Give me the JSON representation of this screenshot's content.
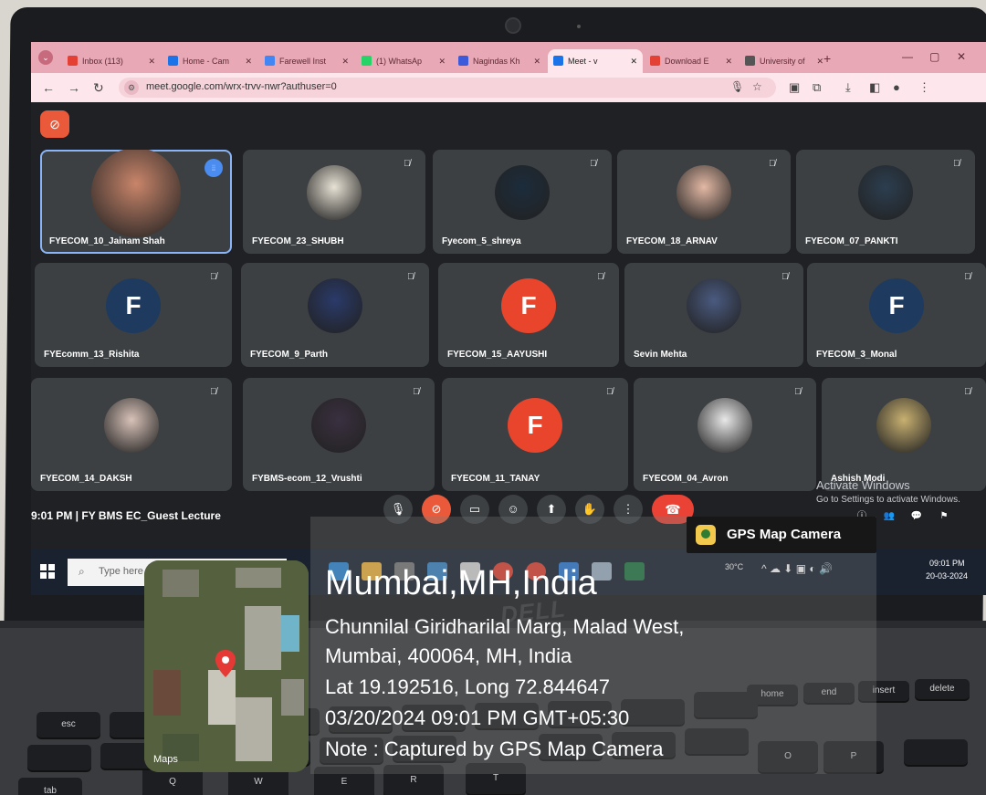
{
  "browser": {
    "tabs": [
      {
        "label": "Inbox (113)",
        "icon": "gmail-icon",
        "color": "#e44134"
      },
      {
        "label": "Home - Cam",
        "icon": "classroom-icon",
        "color": "#1a73e8"
      },
      {
        "label": "Farewell Inst",
        "icon": "docs-icon",
        "color": "#4285f4"
      },
      {
        "label": "(1) WhatsAp",
        "icon": "whatsapp-icon",
        "color": "#25d366"
      },
      {
        "label": "Nagindas Kh",
        "icon": "site-icon",
        "color": "#3b5bdb"
      },
      {
        "label": "Meet - v",
        "icon": "meet-icon",
        "color": "#1a73e8",
        "active": true
      },
      {
        "label": "Download E",
        "icon": "download-icon",
        "color": "#e44134"
      },
      {
        "label": "University of",
        "icon": "university-icon",
        "color": "#555555"
      }
    ],
    "url": "meet.google.com/wrx-trvv-nwr?authuser=0"
  },
  "meet": {
    "participants": [
      {
        "name": "FYECOM_10_Jainam Shah",
        "avatar": "photo",
        "speaking": true
      },
      {
        "name": "FYECOM_23_SHUBH",
        "avatar": "photo"
      },
      {
        "name": "Fyecom_5_shreya",
        "avatar": "photo"
      },
      {
        "name": "FYECOM_18_ARNAV",
        "avatar": "photo"
      },
      {
        "name": "FYECOM_07_PANKTI",
        "avatar": "photo"
      },
      {
        "name": "FYEcomm_13_Rishita",
        "avatar": "letter",
        "letter": "F",
        "color": "#1e3a5f"
      },
      {
        "name": "FYECOM_9_Parth",
        "avatar": "photo"
      },
      {
        "name": "FYECOM_15_AAYUSHI",
        "avatar": "letter",
        "letter": "F",
        "color": "#e8452c"
      },
      {
        "name": "Sevin Mehta",
        "avatar": "photo"
      },
      {
        "name": "FYECOM_3_Monal",
        "avatar": "letter",
        "letter": "F",
        "color": "#1e3a5f"
      },
      {
        "name": "FYECOM_14_DAKSH",
        "avatar": "photo"
      },
      {
        "name": "FYBMS-ecom_12_Vrushti",
        "avatar": "photo"
      },
      {
        "name": "FYECOM_11_TANAY",
        "avatar": "letter",
        "letter": "F",
        "color": "#e8452c"
      },
      {
        "name": "FYECOM_04_Avron",
        "avatar": "photo"
      },
      {
        "name": "Ashish Modi",
        "avatar": "photo"
      }
    ],
    "meeting_info": "9:01 PM  |  FY BMS EC_Guest Lecture"
  },
  "windows": {
    "activate_title": "Activate Windows",
    "activate_sub": "Go to Settings to activate Windows.",
    "search_placeholder": "Type here t",
    "weather": "30°C",
    "clock_time": "09:01 PM",
    "clock_date": "20-03-2024"
  },
  "gps": {
    "app_name": "GPS Map Camera",
    "city": "Mumbai,MH,India",
    "address_line1": "Chunnilal Giridharilal Marg, Malad West,",
    "address_line2": "Mumbai, 400064, MH, India",
    "coordinates": "Lat 19.192516, Long 72.844647",
    "datetime": "03/20/2024 09:01 PM GMT+05:30",
    "note": "Note : Captured by GPS Map Camera",
    "map_label": "Maps"
  },
  "laptop": {
    "brand": "DELL"
  },
  "keyboard": {
    "keys": [
      "esc",
      "tab",
      "Q",
      "W",
      "E",
      "R",
      "T",
      "O",
      "P",
      "home",
      "end",
      "insert",
      "delete"
    ]
  }
}
